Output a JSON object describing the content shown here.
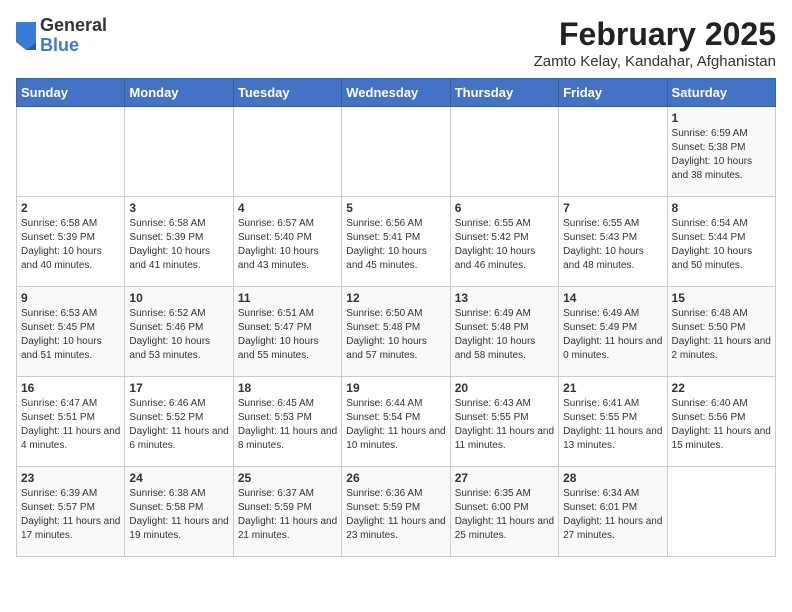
{
  "header": {
    "logo_general": "General",
    "logo_blue": "Blue",
    "title": "February 2025",
    "subtitle": "Zamto Kelay, Kandahar, Afghanistan"
  },
  "weekdays": [
    "Sunday",
    "Monday",
    "Tuesday",
    "Wednesday",
    "Thursday",
    "Friday",
    "Saturday"
  ],
  "weeks": [
    [
      {
        "day": "",
        "info": ""
      },
      {
        "day": "",
        "info": ""
      },
      {
        "day": "",
        "info": ""
      },
      {
        "day": "",
        "info": ""
      },
      {
        "day": "",
        "info": ""
      },
      {
        "day": "",
        "info": ""
      },
      {
        "day": "1",
        "info": "Sunrise: 6:59 AM\nSunset: 5:38 PM\nDaylight: 10 hours and 38 minutes."
      }
    ],
    [
      {
        "day": "2",
        "info": "Sunrise: 6:58 AM\nSunset: 5:39 PM\nDaylight: 10 hours and 40 minutes."
      },
      {
        "day": "3",
        "info": "Sunrise: 6:58 AM\nSunset: 5:39 PM\nDaylight: 10 hours and 41 minutes."
      },
      {
        "day": "4",
        "info": "Sunrise: 6:57 AM\nSunset: 5:40 PM\nDaylight: 10 hours and 43 minutes."
      },
      {
        "day": "5",
        "info": "Sunrise: 6:56 AM\nSunset: 5:41 PM\nDaylight: 10 hours and 45 minutes."
      },
      {
        "day": "6",
        "info": "Sunrise: 6:55 AM\nSunset: 5:42 PM\nDaylight: 10 hours and 46 minutes."
      },
      {
        "day": "7",
        "info": "Sunrise: 6:55 AM\nSunset: 5:43 PM\nDaylight: 10 hours and 48 minutes."
      },
      {
        "day": "8",
        "info": "Sunrise: 6:54 AM\nSunset: 5:44 PM\nDaylight: 10 hours and 50 minutes."
      }
    ],
    [
      {
        "day": "9",
        "info": "Sunrise: 6:53 AM\nSunset: 5:45 PM\nDaylight: 10 hours and 51 minutes."
      },
      {
        "day": "10",
        "info": "Sunrise: 6:52 AM\nSunset: 5:46 PM\nDaylight: 10 hours and 53 minutes."
      },
      {
        "day": "11",
        "info": "Sunrise: 6:51 AM\nSunset: 5:47 PM\nDaylight: 10 hours and 55 minutes."
      },
      {
        "day": "12",
        "info": "Sunrise: 6:50 AM\nSunset: 5:48 PM\nDaylight: 10 hours and 57 minutes."
      },
      {
        "day": "13",
        "info": "Sunrise: 6:49 AM\nSunset: 5:48 PM\nDaylight: 10 hours and 58 minutes."
      },
      {
        "day": "14",
        "info": "Sunrise: 6:49 AM\nSunset: 5:49 PM\nDaylight: 11 hours and 0 minutes."
      },
      {
        "day": "15",
        "info": "Sunrise: 6:48 AM\nSunset: 5:50 PM\nDaylight: 11 hours and 2 minutes."
      }
    ],
    [
      {
        "day": "16",
        "info": "Sunrise: 6:47 AM\nSunset: 5:51 PM\nDaylight: 11 hours and 4 minutes."
      },
      {
        "day": "17",
        "info": "Sunrise: 6:46 AM\nSunset: 5:52 PM\nDaylight: 11 hours and 6 minutes."
      },
      {
        "day": "18",
        "info": "Sunrise: 6:45 AM\nSunset: 5:53 PM\nDaylight: 11 hours and 8 minutes."
      },
      {
        "day": "19",
        "info": "Sunrise: 6:44 AM\nSunset: 5:54 PM\nDaylight: 11 hours and 10 minutes."
      },
      {
        "day": "20",
        "info": "Sunrise: 6:43 AM\nSunset: 5:55 PM\nDaylight: 11 hours and 11 minutes."
      },
      {
        "day": "21",
        "info": "Sunrise: 6:41 AM\nSunset: 5:55 PM\nDaylight: 11 hours and 13 minutes."
      },
      {
        "day": "22",
        "info": "Sunrise: 6:40 AM\nSunset: 5:56 PM\nDaylight: 11 hours and 15 minutes."
      }
    ],
    [
      {
        "day": "23",
        "info": "Sunrise: 6:39 AM\nSunset: 5:57 PM\nDaylight: 11 hours and 17 minutes."
      },
      {
        "day": "24",
        "info": "Sunrise: 6:38 AM\nSunset: 5:58 PM\nDaylight: 11 hours and 19 minutes."
      },
      {
        "day": "25",
        "info": "Sunrise: 6:37 AM\nSunset: 5:59 PM\nDaylight: 11 hours and 21 minutes."
      },
      {
        "day": "26",
        "info": "Sunrise: 6:36 AM\nSunset: 5:59 PM\nDaylight: 11 hours and 23 minutes."
      },
      {
        "day": "27",
        "info": "Sunrise: 6:35 AM\nSunset: 6:00 PM\nDaylight: 11 hours and 25 minutes."
      },
      {
        "day": "28",
        "info": "Sunrise: 6:34 AM\nSunset: 6:01 PM\nDaylight: 11 hours and 27 minutes."
      },
      {
        "day": "",
        "info": ""
      }
    ]
  ]
}
